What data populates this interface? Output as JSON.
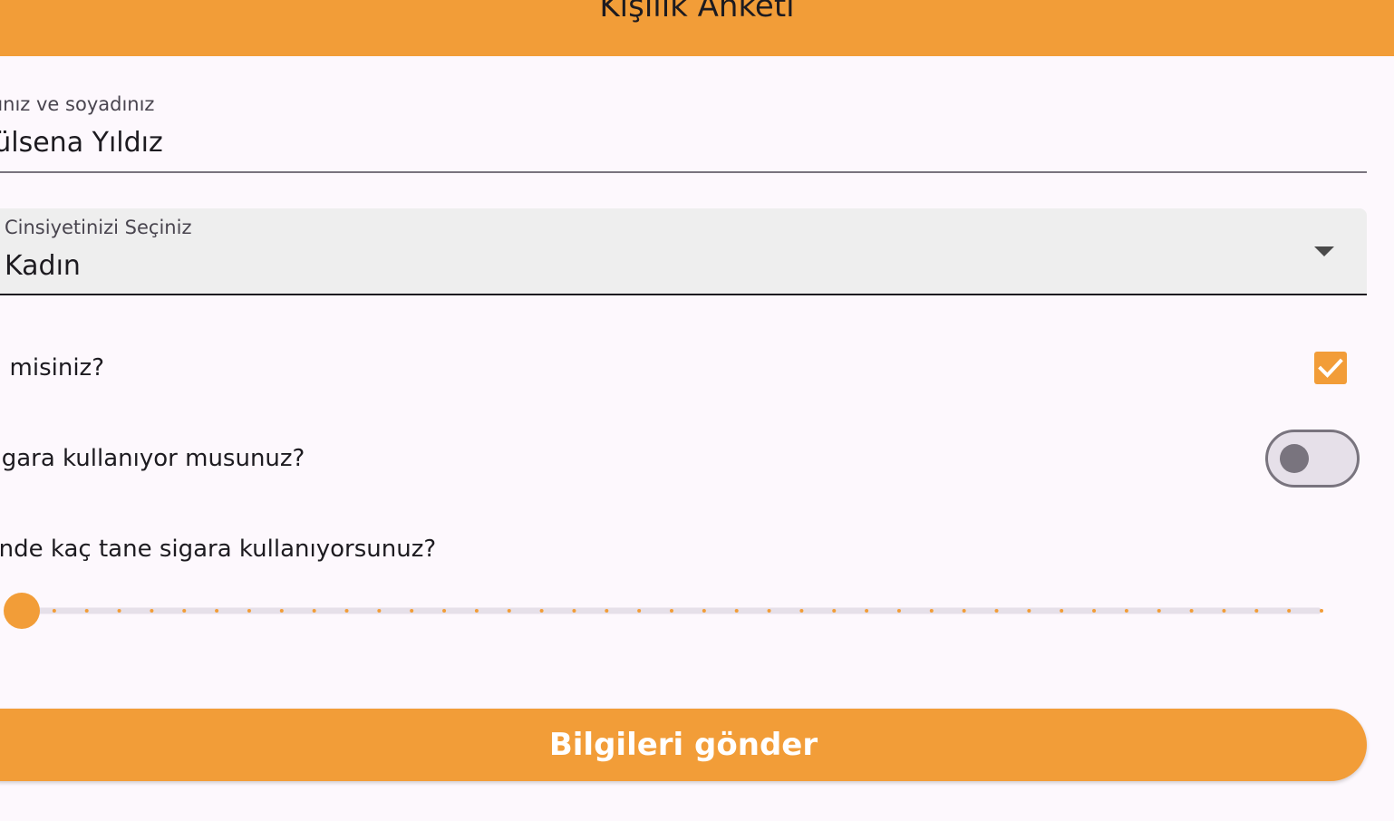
{
  "app_bar": {
    "title": "Kişilik Anketi"
  },
  "name_field": {
    "label": "Adınız ve soyadınız",
    "value": "Gülsena Yıldız"
  },
  "gender_select": {
    "label": "Cinsiyetinizi Seçiniz",
    "value": "Kadın"
  },
  "married_question": {
    "label": "Evli misiniz?",
    "checked": true
  },
  "smoking_question": {
    "label": "Sigara kullanıyor musunuz?",
    "on": false
  },
  "cigarettes_question": {
    "label": "Günde kaç tane sigara kullanıyorsunuz?",
    "value": 0,
    "min": 0,
    "max": 40
  },
  "submit": {
    "label": "Bilgileri gönder"
  },
  "colors": {
    "primary": "#f29d38",
    "background": "#fdf8fd",
    "outline": "#79747e",
    "track": "#e6e0e9"
  }
}
